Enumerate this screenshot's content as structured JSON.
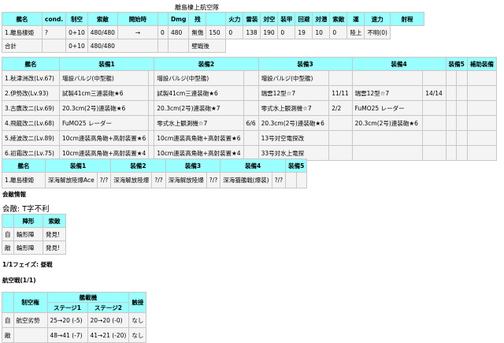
{
  "page_title": "離島棲上航空隊",
  "enemy": {
    "headers": [
      "艦名",
      "cond.",
      "制空",
      "索敵",
      "開始時",
      "",
      "Dmg",
      "残",
      "",
      "火力",
      "雷装",
      "対空",
      "装甲",
      "回避",
      "対潜",
      "索敵",
      "運",
      "速力",
      "射程"
    ],
    "rows": [
      [
        "1.離島棲姫",
        "?",
        "0+10",
        "480/480",
        "→",
        "0",
        "480",
        "無傷",
        "150",
        "0",
        "138",
        "190",
        "0",
        "19",
        "10",
        "0",
        "陸上",
        "不明(0)"
      ]
    ],
    "total": {
      "label": "合計",
      "seiku": "0+10",
      "hp": "480/480",
      "status": "壁戦後"
    }
  },
  "equip": {
    "headers": [
      "艦名",
      "装備1",
      "装備2",
      "装備3",
      "装備4",
      "装備5",
      "補助装備"
    ],
    "rows": [
      {
        "name": "1.秋津洲改(Lv.67)",
        "e1": "増設バルジ(中型艦)",
        "e1c": "",
        "e2": "増設バルジ(中型艦)",
        "e2c": "",
        "e3": "増設バルジ(中型艦)",
        "e3c": "",
        "e4": "",
        "e4c": ""
      },
      {
        "name": "2.伊勢改(Lv.93)",
        "e1": "試製41cm三連装砲★6",
        "e1c": "",
        "e2": "試製41cm三連装砲★6",
        "e2c": "",
        "e3": "瑞雲12型☆7",
        "e3c": "11/11",
        "e4": "瑞雲12型☆7",
        "e4c": "14/14"
      },
      {
        "name": "3.古鷹改二(Lv.69)",
        "e1": "20.3cm(2号)連装砲★6",
        "e1c": "",
        "e2": "20.3cm(2号)連装砲★7",
        "e2c": "",
        "e3": "零式水上観測機☆7",
        "e3c": "2/2",
        "e4": "FuMO25 レーダー",
        "e4c": ""
      },
      {
        "name": "4.飛龍改二(Lv.68)",
        "e1": "FuMO25 レーダー",
        "e1c": "",
        "e2": "零式水上観測機☆7",
        "e2c": "6/6",
        "e3": "20.3cm(2号)連装砲★6",
        "e3c": "",
        "e4": "20.3cm(2号)連装砲★6",
        "e4c": ""
      },
      {
        "name": "5.綾波改二(Lv.89)",
        "e1": "10cm連装高角砲+高射装置★6",
        "e1c": "",
        "e2": "10cm連装高角砲+高射装置★6",
        "e2c": "",
        "e3": "13号対空電探改",
        "e3c": "",
        "e4": "",
        "e4c": ""
      },
      {
        "name": "6.初霜改二(Lv.75)",
        "e1": "10cm連装高角砲+高射装置★4",
        "e1c": "",
        "e2": "10cm連装高角砲+高射装置★4",
        "e2c": "",
        "e3": "33号対水上電探",
        "e3c": "",
        "e4": "",
        "e4c": ""
      }
    ]
  },
  "enemy_equip": {
    "headers": [
      "艦名",
      "装備1",
      "装備2",
      "装備3",
      "装備4",
      "装備5"
    ],
    "rows": [
      {
        "name": "1.離島棲姫",
        "e1": "深海解放陸爆Ace",
        "e1c": "?/?",
        "e2": "深海解放陸爆",
        "e2c": "?/?",
        "e3": "深海解放陸爆",
        "e3c": "?/?",
        "e4": "深海猫艦戦(爆装)",
        "e4c": "?/?"
      }
    ]
  },
  "battle_info": {
    "heading": "会敵情報",
    "formation_line": "会敵: T字不利",
    "form_headers": [
      "陣形",
      "索敵"
    ],
    "form_rows": [
      {
        "side": "自",
        "form": "輪形陣",
        "scout": "発見!"
      },
      {
        "side": "敵",
        "form": "輪形陣",
        "scout": "発見!"
      }
    ]
  },
  "phase_label": "1/1フェイズ: 昼戦",
  "air_label": "航空戦(1/1)",
  "air": {
    "h_control": "制空権",
    "h_planes": "艦載機",
    "h_stage1": "ステージ1",
    "h_stage2": "ステージ2",
    "h_contact": "触接",
    "rows": [
      {
        "side": "自",
        "control": "航空劣勢",
        "s1": "25→20 (-5)",
        "s2": "20→20 (-0)",
        "contact": "なし"
      },
      {
        "side": "敵",
        "control": "",
        "s1": "48→41 (-7)",
        "s2": "41→21 (-20)",
        "contact": "なし"
      }
    ]
  }
}
